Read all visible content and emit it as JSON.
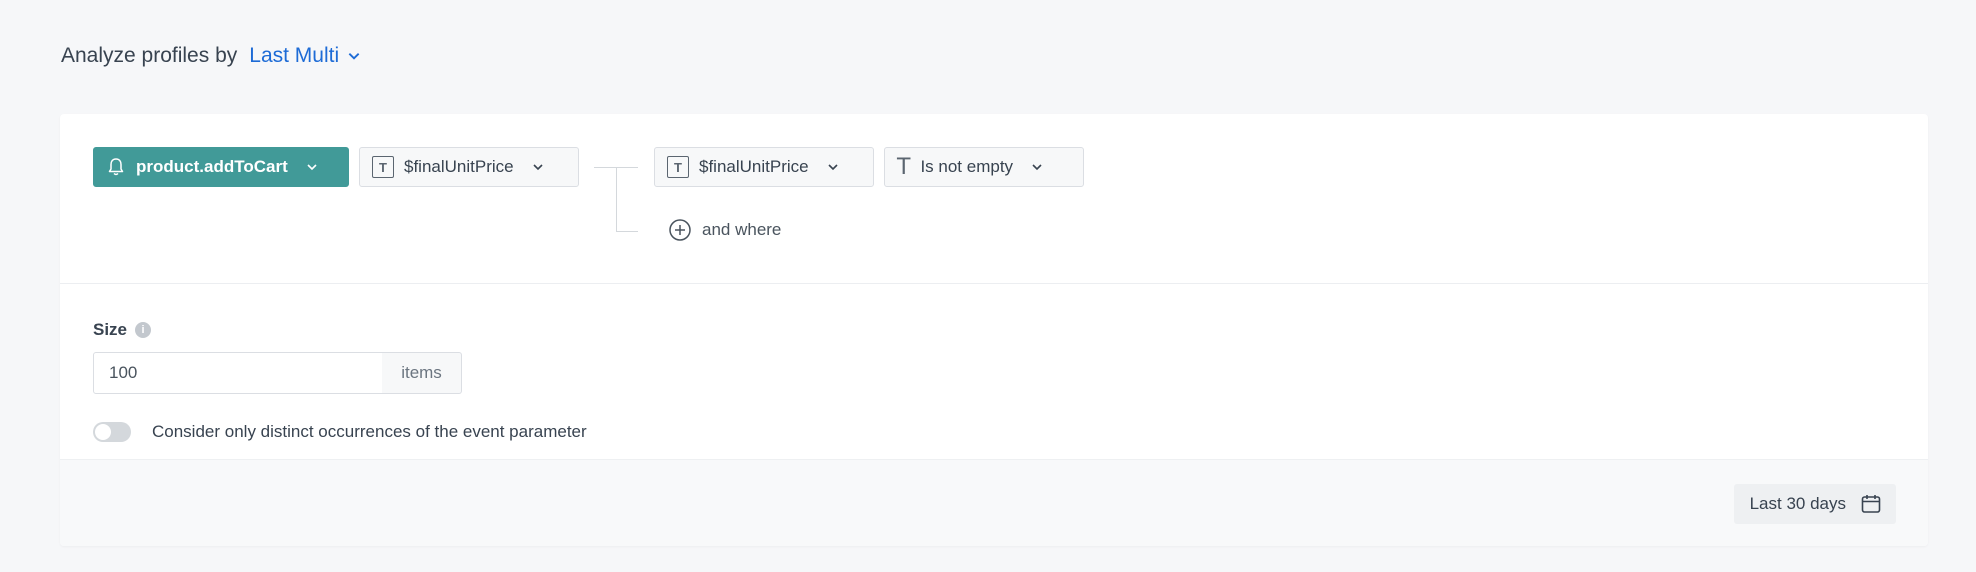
{
  "header": {
    "title": "Analyze profiles by",
    "mode": "Last Multi"
  },
  "filter": {
    "event": "product.addToCart",
    "parameter": "$finalUnitPrice",
    "condition_parameter": "$finalUnitPrice",
    "operator": "Is not empty",
    "and_where": "and where"
  },
  "size": {
    "label": "Size",
    "value": "100",
    "unit": "items"
  },
  "distinct": {
    "label": "Consider only distinct occurrences of the event parameter",
    "enabled": false
  },
  "date_range": {
    "label": "Last 30 days"
  },
  "icons": {
    "chevron": "chevron-down-icon",
    "bell": "bell-icon",
    "text_type": "text-type-icon",
    "plus_circle": "plus-circle-icon",
    "info": "info-icon",
    "calendar": "calendar-icon"
  },
  "colors": {
    "accent": "#1d6bd6",
    "event_pill": "#419a98"
  }
}
